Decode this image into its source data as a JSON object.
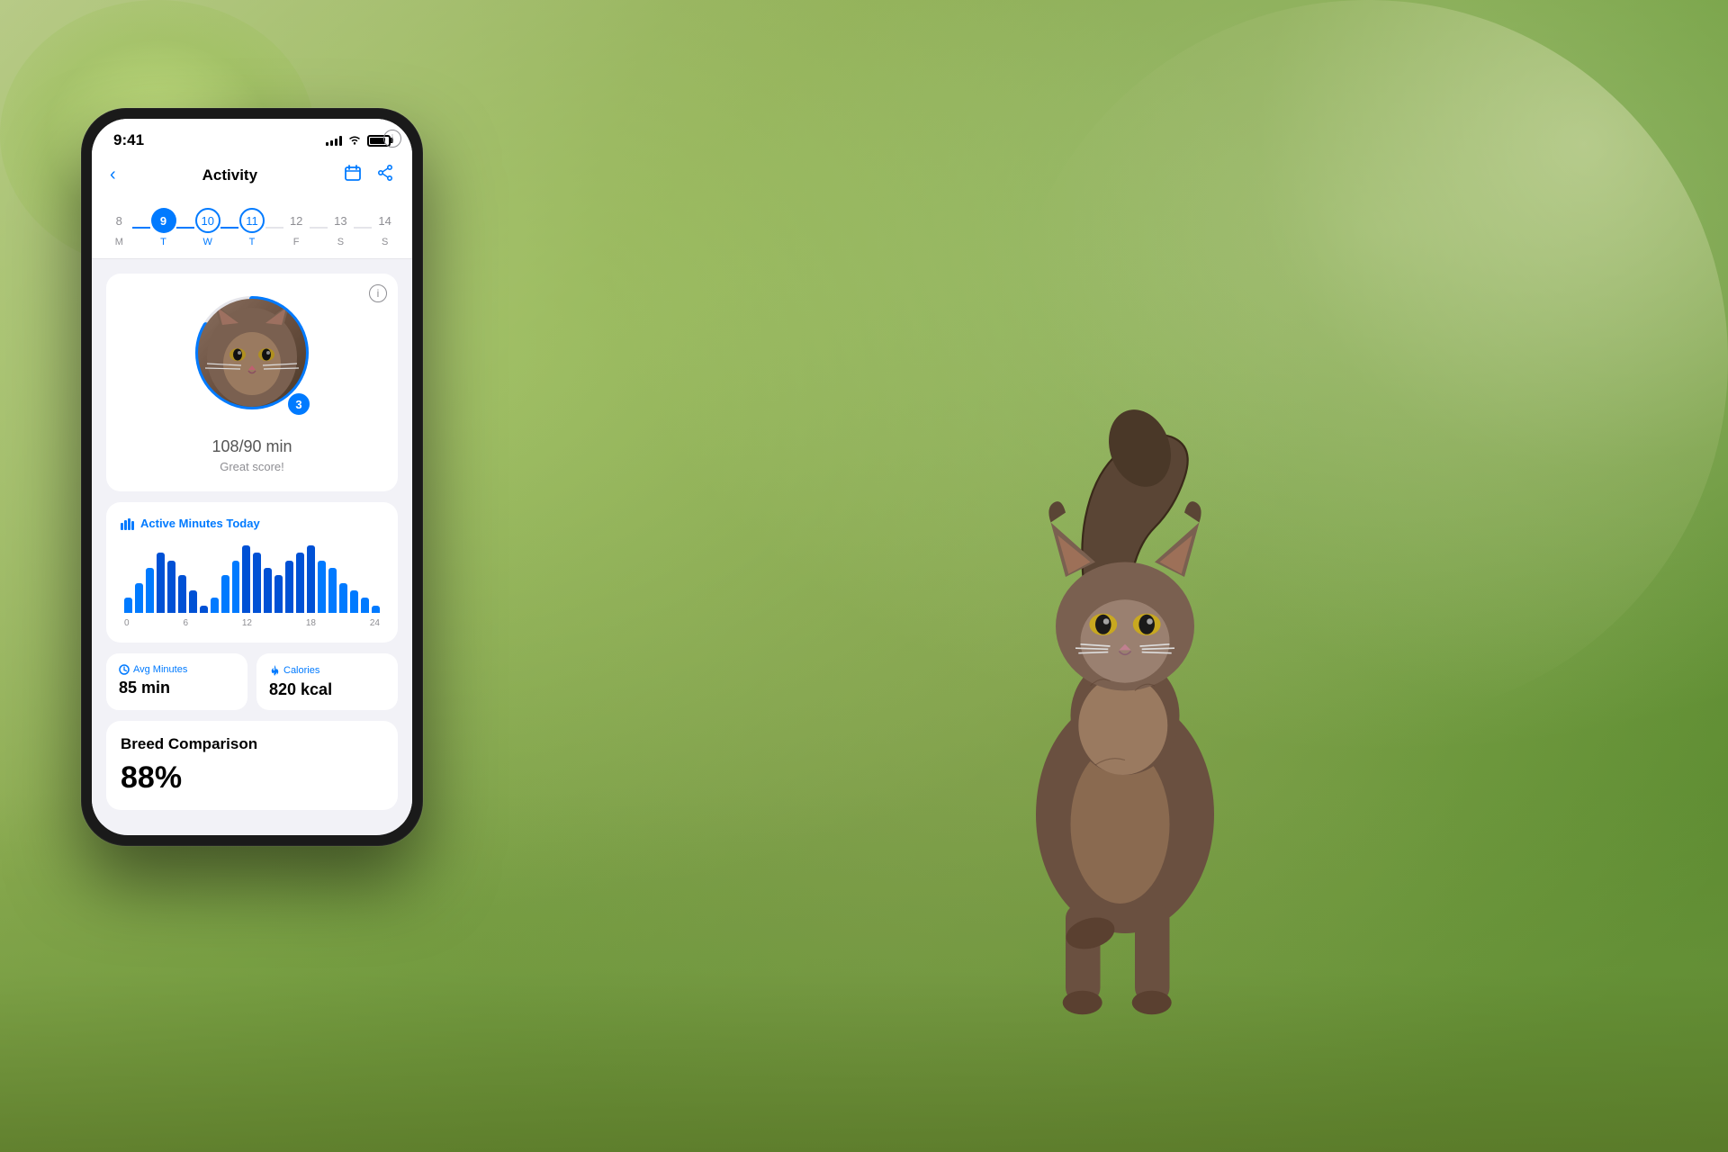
{
  "background": {
    "description": "Blurred outdoor garden with cat"
  },
  "phone": {
    "status_bar": {
      "time": "9:41",
      "signal": "signal",
      "wifi": "wifi",
      "battery": "battery"
    },
    "nav": {
      "back_label": "‹",
      "title": "Activity",
      "calendar_icon": "calendar",
      "share_icon": "share"
    },
    "days": [
      {
        "number": "8",
        "label": "M",
        "state": "inactive"
      },
      {
        "number": "9",
        "label": "T",
        "state": "active"
      },
      {
        "number": "10",
        "label": "W",
        "state": "connected"
      },
      {
        "number": "11",
        "label": "T",
        "state": "connected"
      },
      {
        "number": "12",
        "label": "F",
        "state": "inactive"
      },
      {
        "number": "13",
        "label": "S",
        "state": "inactive"
      },
      {
        "number": "14",
        "label": "S",
        "state": "inactive"
      }
    ],
    "score_card": {
      "score_value": "108",
      "score_max": "/90 min",
      "score_label": "Great score!",
      "level": "3",
      "info": "ℹ"
    },
    "chart": {
      "title": "Active Minutes Today",
      "chart_icon": "bar-chart",
      "bars": [
        2,
        4,
        6,
        8,
        7,
        5,
        3,
        1,
        2,
        5,
        7,
        9,
        8,
        6,
        5,
        7,
        8,
        9,
        7,
        6,
        4,
        3,
        2,
        1
      ],
      "labels": [
        "0",
        "6",
        "12",
        "18",
        "24"
      ]
    },
    "stats": [
      {
        "label": "Avg Minutes",
        "icon": "clock",
        "value": "85 min"
      },
      {
        "label": "Calories",
        "icon": "flame",
        "value": "820 kcal"
      }
    ],
    "breed": {
      "title": "Breed Comparison",
      "percent": "88%",
      "info": "ℹ"
    }
  },
  "colors": {
    "blue": "#007AFF",
    "dark_blue": "#0051D5",
    "bg": "#f2f2f7",
    "card": "#ffffff",
    "text_primary": "#000000",
    "text_secondary": "#8e8e93"
  }
}
